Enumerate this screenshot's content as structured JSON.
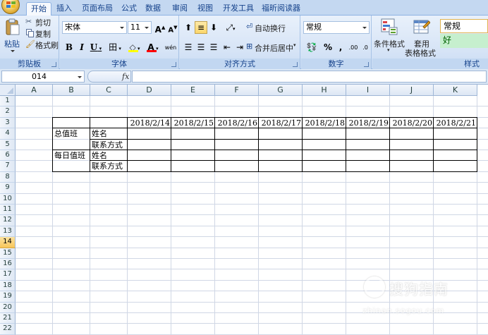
{
  "tabs": [
    "开始",
    "插入",
    "页面布局",
    "公式",
    "数据",
    "审阅",
    "视图",
    "开发工具",
    "福昕阅读器"
  ],
  "active_tab": 0,
  "clipboard": {
    "paste_label": "粘贴",
    "cut_label": "剪切",
    "copy_label": "复制",
    "format_painter_label": "格式刷",
    "group_label": "剪贴板"
  },
  "font": {
    "font_name": "宋体",
    "font_size": "11",
    "grow_label": "A",
    "shrink_label": "A",
    "bold_label": "B",
    "italic_label": "I",
    "underline_label": "U",
    "border_label": "田",
    "fill_label": "◇",
    "color_label": "A",
    "phonetic_label": "wén",
    "group_label": "字体"
  },
  "alignment": {
    "wrap_text_label": "自动换行",
    "merge_center_label": "合并后居中",
    "group_label": "对齐方式"
  },
  "number": {
    "format": "常规",
    "percent_label": "%",
    "comma_label": ",",
    "inc_decimal_label": ".00",
    "dec_decimal_label": ".0",
    "group_label": "数字"
  },
  "styles": {
    "conditional_format_label": "条件格式",
    "table_format_label_1": "套用",
    "table_format_label_2": "表格格式",
    "style_normal": "常规",
    "style_good": "好",
    "group_label": "样式"
  },
  "formula_bar": {
    "name_box": "014",
    "fx_label": "fx",
    "formula": ""
  },
  "columns": [
    "A",
    "B",
    "C",
    "D",
    "E",
    "F",
    "G",
    "H",
    "I",
    "J",
    "K"
  ],
  "rows": [
    "1",
    "2",
    "3",
    "4",
    "5",
    "6",
    "7",
    "8",
    "9",
    "10",
    "11",
    "12",
    "13",
    "14",
    "15",
    "16",
    "17",
    "18",
    "19",
    "20",
    "21",
    "22"
  ],
  "selected_row": "14",
  "table": {
    "dates": [
      "2018/2/14",
      "2018/2/15",
      "2018/2/16",
      "2018/2/17",
      "2018/2/18",
      "2018/2/19",
      "2018/2/20",
      "2018/2/21"
    ],
    "group1": "总值班",
    "group2": "每日值班",
    "name_label": "姓名",
    "contact_label": "联系方式"
  },
  "watermark": {
    "text": "搜狗指南",
    "url": "zhinan.sogou.com"
  }
}
